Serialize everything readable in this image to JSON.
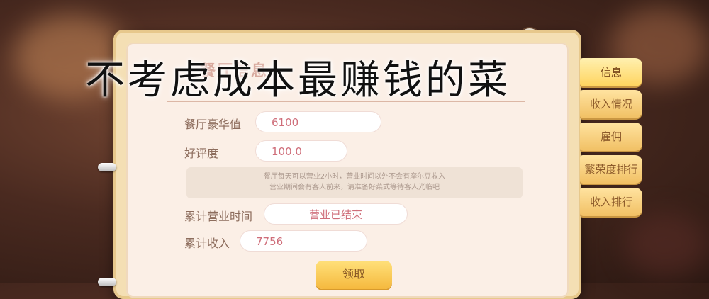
{
  "overlay_caption": "不考虑成本最赚钱的菜",
  "panel": {
    "title_partial": "餐厅信息",
    "rows": [
      {
        "label": "餐厅豪华值",
        "value": "6100"
      },
      {
        "label": "好评度",
        "value": "100.0"
      }
    ],
    "note_line1": "餐厅每天可以营业2小时，营业时间以外不会有摩尔豆收入",
    "note_line2": "营业期间会有客人前来，请准备好菜式等待客人光临吧",
    "business_time": {
      "label": "累计营业时间",
      "value": "营业已结束"
    },
    "income": {
      "label": "累计收入",
      "value": "7756"
    },
    "claim_button": "领取"
  },
  "tabs": [
    {
      "label": "信息",
      "active": true
    },
    {
      "label": "收入情况",
      "active": false
    },
    {
      "label": "雇佣",
      "active": false
    },
    {
      "label": "繁荣度排行",
      "active": false
    },
    {
      "label": "收入排行",
      "active": false
    }
  ],
  "mascot_icon": "cat-face-icon"
}
